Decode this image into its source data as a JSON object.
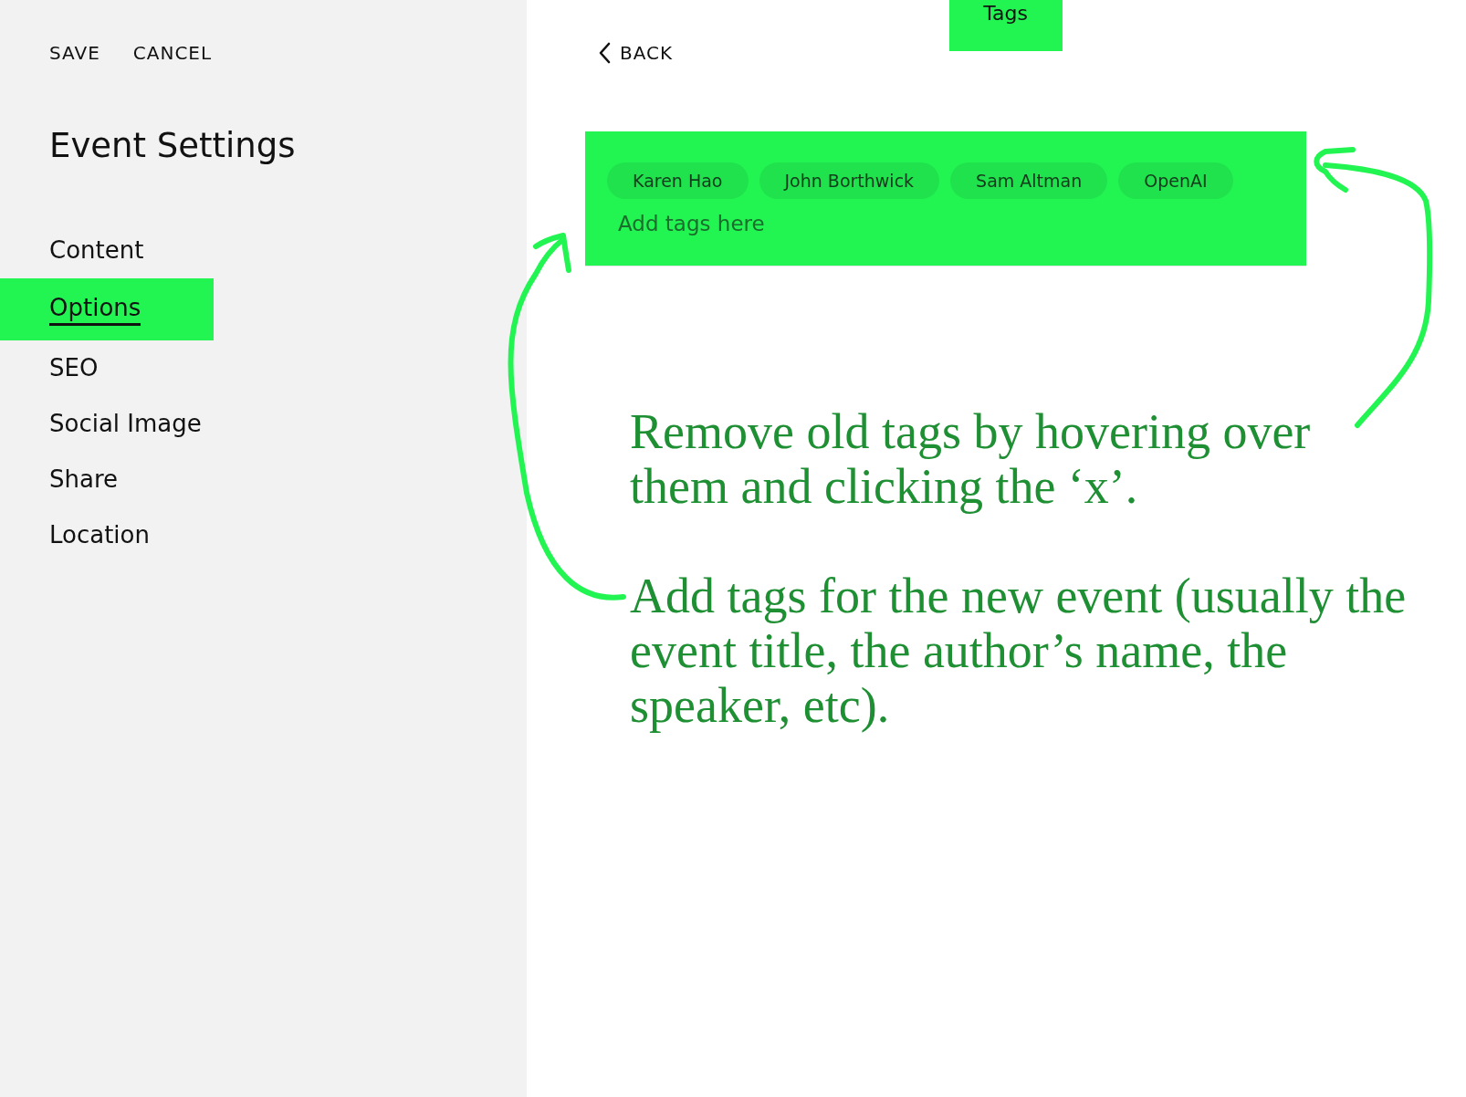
{
  "sidebar": {
    "actions": [
      "SAVE",
      "CANCEL"
    ],
    "title": "Event Settings",
    "items": [
      {
        "label": "Content",
        "selected": false
      },
      {
        "label": "Options",
        "selected": true
      },
      {
        "label": "SEO",
        "selected": false
      },
      {
        "label": "Social Image",
        "selected": false
      },
      {
        "label": "Share",
        "selected": false
      },
      {
        "label": "Location",
        "selected": false
      }
    ]
  },
  "panel": {
    "back": "BACK",
    "title": "Tags",
    "tags": [
      "Karen Hao",
      "John Borthwick",
      "Sam Altman",
      "OpenAI"
    ],
    "placeholder": "Add tags here"
  },
  "annotations": [
    "Remove old tags by hovering over them and clicking the ‘x’.",
    "Add tags for the new event (usually the event title, the author’s name,  the speaker, etc)."
  ]
}
